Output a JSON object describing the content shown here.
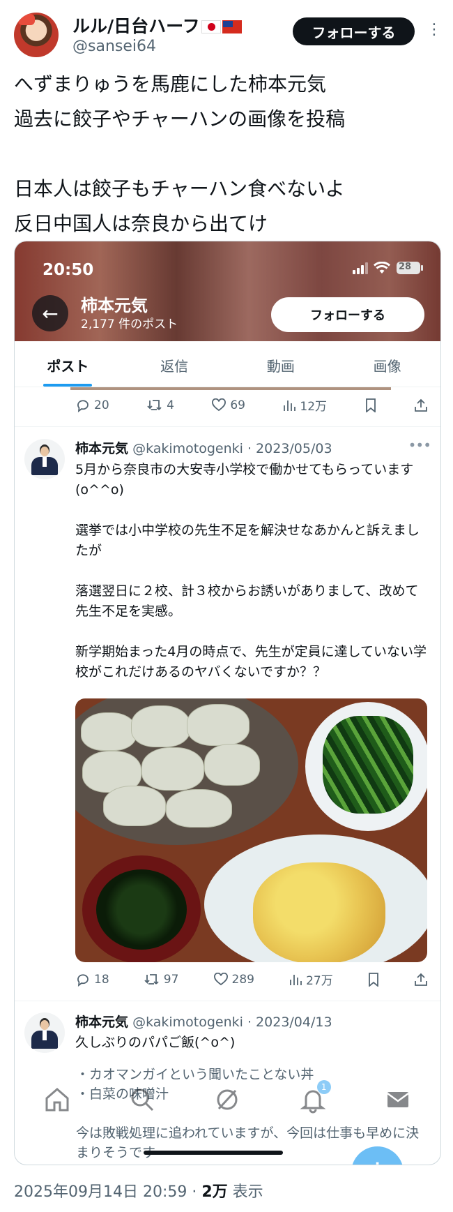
{
  "author": {
    "display_name": "ルル/日台ハーフ",
    "handle": "@sansei64",
    "follow_label": "フォローする",
    "more": "•••"
  },
  "post": {
    "text": "へずまりゅうを馬鹿にした柿本元気\n過去に餃子やチャーハンの画像を投稿\n\n日本人は餃子もチャーハン食べないよ\n反日中国人は奈良から出てけ"
  },
  "screenshot": {
    "status_time": "20:50",
    "battery": "28",
    "profile_name": "柿本元気",
    "profile_count": "2,177 件のポスト",
    "follow_label": "フォローする",
    "tabs": [
      "ポスト",
      "返信",
      "動画",
      "画像"
    ],
    "actions_top": {
      "replies": "20",
      "reposts": "4",
      "likes": "69",
      "views": "12万"
    },
    "tweet1": {
      "name": "柿本元気",
      "meta": "@kakimotogenki · 2023/05/03",
      "text": "5月から奈良市の大安寺小学校で働かせてもらっています(o^^o)\n\n選挙では小中学校の先生不足を解決せなあかんと訴えましたが\n\n落選翌日に２校、計３校からお誘いがありまして、改めて先生不足を実感。\n\n新学期始まった4月の時点で、先生が定員に達していない学校がこれだけあるのヤバくないですか？？",
      "actions": {
        "replies": "18",
        "reposts": "97",
        "likes": "289",
        "views": "27万"
      }
    },
    "tweet2": {
      "name": "柿本元気",
      "meta": "@kakimotogenki · 2023/04/13",
      "text": "久しぶりのパパご飯(^o^)",
      "ghost_text": "・カオマンガイという聞いたことない丼\n・白菜の味噌汁\n\n今は敗戦処理に追われていますが、今回は仕事も早めに決まりそうです",
      "notif_count": "1"
    },
    "fab_label": "+"
  },
  "footer": {
    "timestamp": "2025年09月14日 20:59 · ",
    "views_number": "2万",
    "views_label": " 表示"
  }
}
